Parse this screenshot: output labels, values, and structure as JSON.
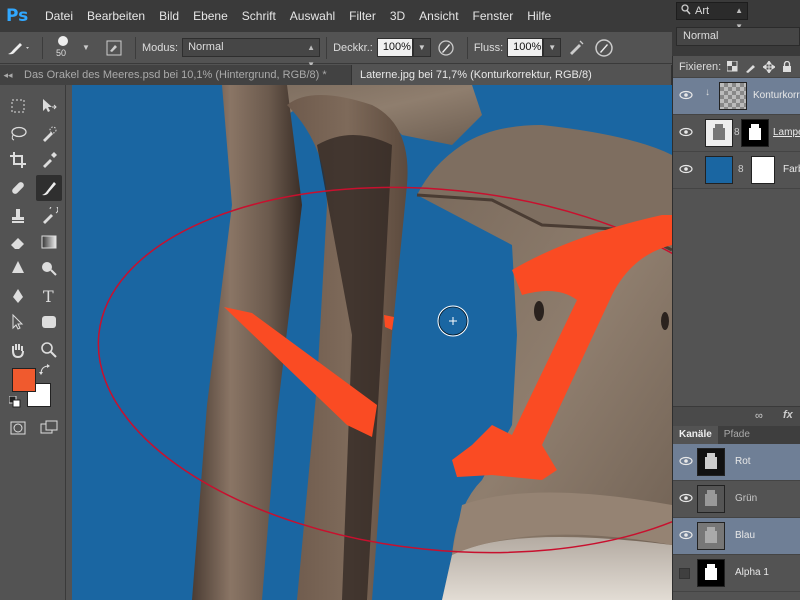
{
  "app": {
    "logo": "Ps"
  },
  "menu": [
    "Datei",
    "Bearbeiten",
    "Bild",
    "Ebene",
    "Schrift",
    "Auswahl",
    "Filter",
    "3D",
    "Ansicht",
    "Fenster",
    "Hilfe"
  ],
  "options": {
    "brush_size": "50",
    "mode_label": "Modus:",
    "mode_value": "Normal",
    "opacity_label": "Deckkr.:",
    "opacity_value": "100%",
    "flow_label": "Fluss:",
    "flow_value": "100%"
  },
  "tabs": [
    {
      "label": "Das Orakel des Meeres.psd bei 10,1% (Hintergrund, RGB/8) *",
      "active": false
    },
    {
      "label": "Laterne.jpg bei 71,7% (Konturkorrektur, RGB/8)",
      "active": true
    }
  ],
  "colors": {
    "foreground": "#f05a2e",
    "background": "#ffffff",
    "canvas_blue": "#1a66a2",
    "annotation": "#fa4b23",
    "ellipse": "#c8102e",
    "selected_row": "#6f7f96"
  },
  "layers_panel": {
    "kind_filter": "Art",
    "blend_mode": "Normal",
    "lock_label": "Fixieren:",
    "layers": [
      {
        "name": "Konturkorr",
        "selected": true,
        "visible": true
      },
      {
        "name": "Lampe",
        "selected": false,
        "visible": true
      },
      {
        "name": "Farb",
        "selected": false,
        "visible": true
      }
    ],
    "footer_fx": "fx"
  },
  "channels_panel": {
    "tabs": [
      "Kanäle",
      "Pfade"
    ],
    "channels": [
      {
        "name": "Rot",
        "selected": true,
        "visible": true
      },
      {
        "name": "Grün",
        "selected": false,
        "visible": true
      },
      {
        "name": "Blau",
        "selected": true,
        "visible": true
      },
      {
        "name": "Alpha 1",
        "selected": false,
        "visible": false
      }
    ]
  }
}
